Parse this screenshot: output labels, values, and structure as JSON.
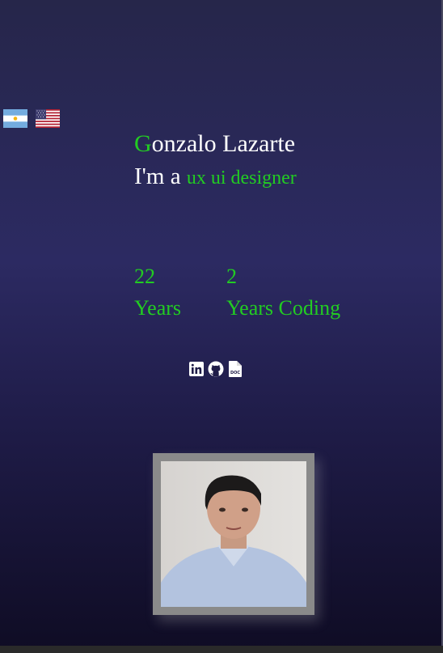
{
  "flags": [
    {
      "name": "argentina-flag-icon",
      "country": "Argentina"
    },
    {
      "name": "usa-flag-icon",
      "country": "United States"
    }
  ],
  "hero": {
    "name_initial": "G",
    "name_rest": "onzalo Lazarte",
    "role_prefix": "I'm a ",
    "role_title": "ux ui designer"
  },
  "stats": [
    {
      "value": "22",
      "label": "Years"
    },
    {
      "value": "2",
      "label": "Years Coding"
    }
  ],
  "socials": [
    {
      "icon": "linkedin-icon"
    },
    {
      "icon": "github-icon"
    },
    {
      "icon": "document-icon",
      "text": "DOC"
    }
  ],
  "colors": {
    "accent": "#22cc22",
    "text": "#ffffff",
    "frame": "#8a8a8a"
  }
}
